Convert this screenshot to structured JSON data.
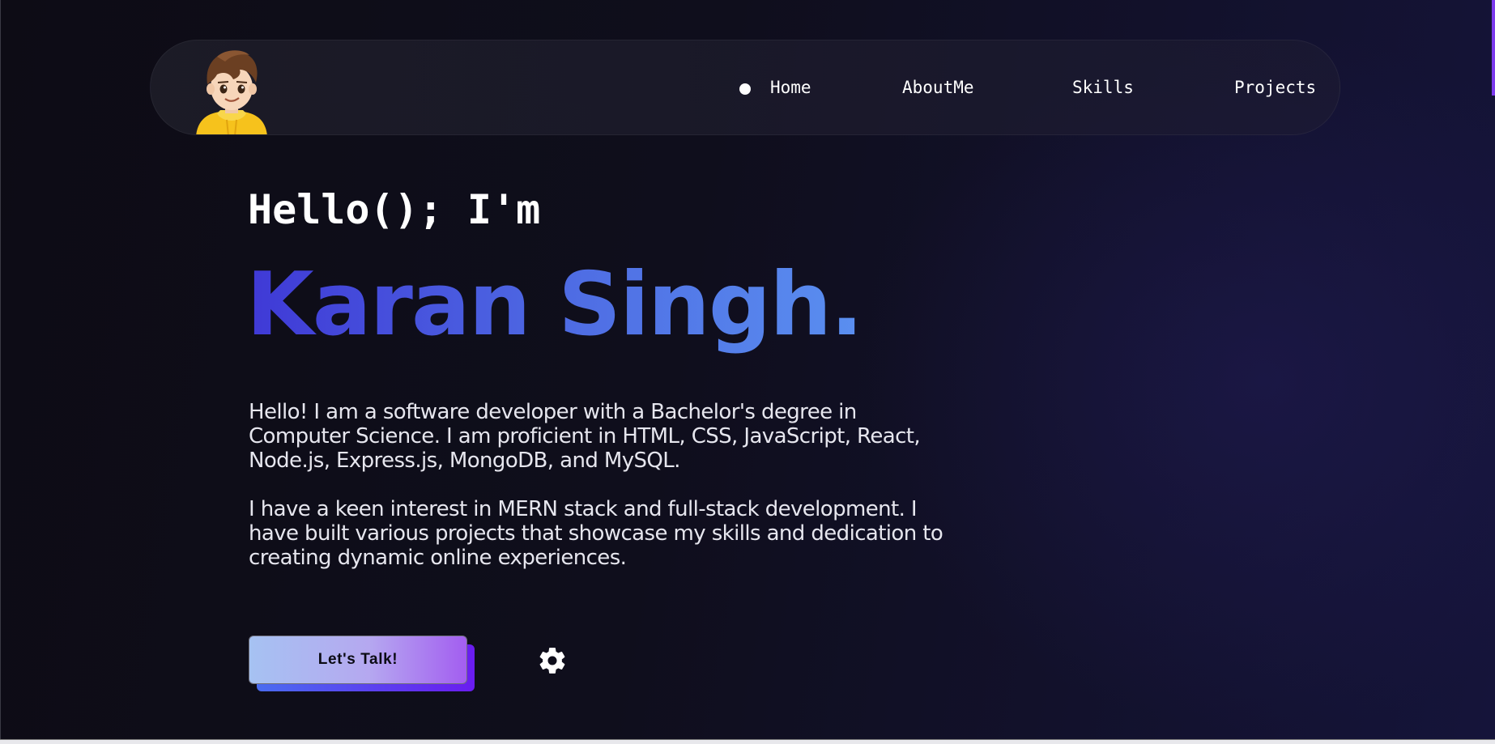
{
  "nav": {
    "items": [
      {
        "label": "Home",
        "active": true
      },
      {
        "label": "AboutMe",
        "active": false
      },
      {
        "label": "Skills",
        "active": false
      },
      {
        "label": "Projects",
        "active": false
      }
    ],
    "avatar_icon": "cartoon-developer-avatar"
  },
  "hero": {
    "greeting": "Hello(); I'm",
    "name": "Karan Singh.",
    "bio": [
      "Hello! I am a software developer with a Bachelor's degree in Computer Science. I am proficient in HTML, CSS, JavaScript, React, Node.js, Express.js, MongoDB, and MySQL.",
      "I have a keen interest in MERN stack and full-stack development. I have built various projects that showcase my skills and dedication to creating dynamic online experiences."
    ],
    "cta_label": "Let's Talk!",
    "settings_icon": "gear-icon"
  },
  "colors": {
    "background": "#0e0d17",
    "name_gradient_start": "#3f39d6",
    "name_gradient_end": "#5a8ff0",
    "accent": "#7c3aed"
  }
}
